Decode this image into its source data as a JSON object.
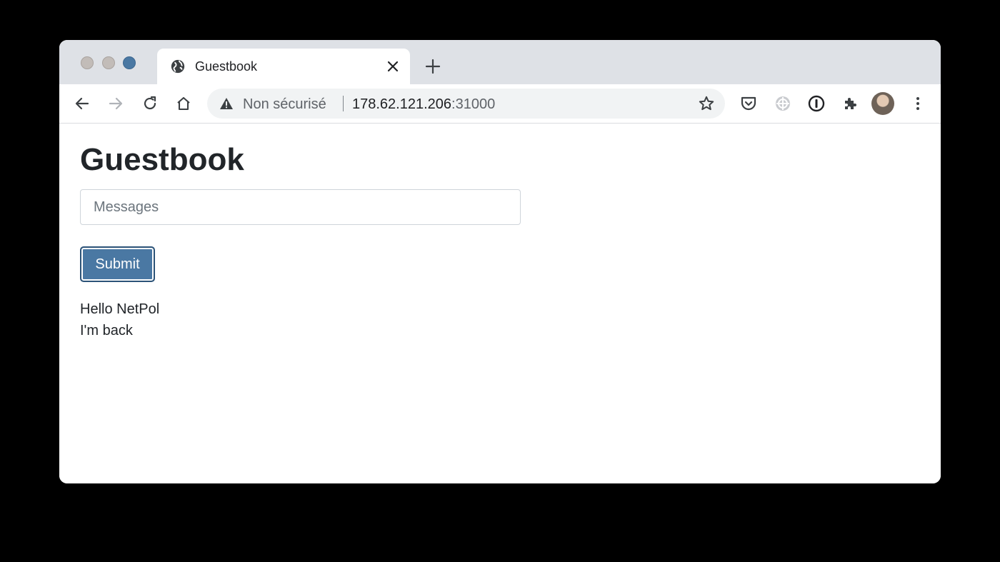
{
  "browser": {
    "tab": {
      "title": "Guestbook"
    },
    "address_bar": {
      "security_label": "Non sécurisé",
      "host": "178.62.121.206",
      "port": ":31000"
    },
    "extensions": [
      "pocket-icon",
      "extension-icon",
      "password-manager-icon",
      "puzzle-icon"
    ],
    "accent_color": "#4a78a3"
  },
  "page": {
    "title": "Guestbook",
    "message_input": {
      "placeholder": "Messages",
      "value": ""
    },
    "submit_label": "Submit",
    "entries": [
      "Hello NetPol",
      "I'm back"
    ]
  },
  "colors": {
    "titlebar": "#dee1e6",
    "button": "#4a78a3",
    "text": "#212529"
  }
}
